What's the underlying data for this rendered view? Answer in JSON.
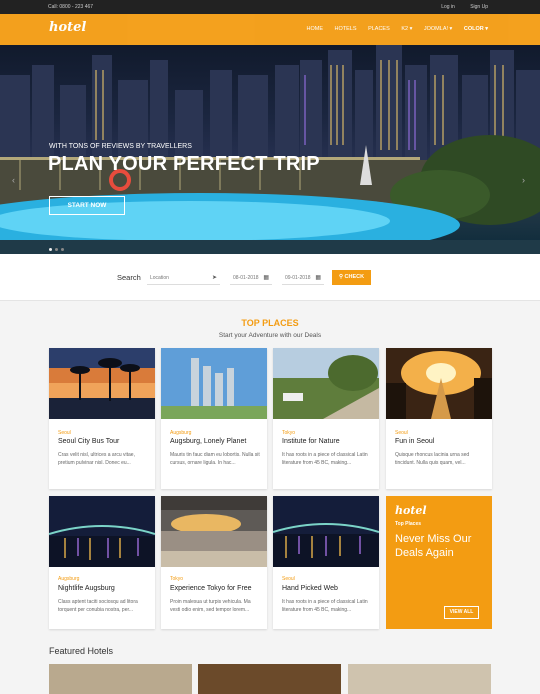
{
  "topbar": {
    "call": "Call: 0800 - 223 467",
    "login": "Log in",
    "signup": "Sign Up"
  },
  "nav": {
    "logo": "hotel",
    "items": [
      "HOME",
      "HOTELS",
      "PLACES",
      "K2 ▾",
      "JOOMLA! ▾",
      "COLOR ▾"
    ]
  },
  "hero": {
    "subtitle": "WITH TONS OF REVIEWS BY TRAVELLERS",
    "title": "PLAN YOUR PERFECT TRIP",
    "button": "START NOW",
    "prev": "‹",
    "next": "›"
  },
  "search": {
    "label": "Search",
    "location_placeholder": "Location",
    "checkin": "08-01-2018",
    "checkout": "09-01-2018",
    "button": "CHECK"
  },
  "top_places": {
    "title": "TOP PLACES",
    "subtitle": "Start your Adventure with our Deals",
    "cards": [
      {
        "category": "Seoul",
        "name": "Seoul City Bus Tour",
        "desc": "Cras velit nisl, ultrices a arcu vitae, pretium pulvinar nisl. Donec eu..."
      },
      {
        "category": "Augsburg",
        "name": "Augsburg, Lonely Planet",
        "desc": "Mauris tin fauc diam eu lobortis. Nulla sit cursus, ornare ligula. In hac..."
      },
      {
        "category": "Tokyo",
        "name": "Institute for Nature",
        "desc": "It has roots in a piece of classical Latin literature from 45 BC, making..."
      },
      {
        "category": "Seoul",
        "name": "Fun in Seoul",
        "desc": "Quisque rhoncus lacinia urna sed tincidunt. Nulla quis quam, vel..."
      },
      {
        "category": "Augsburg",
        "name": "Nightlife Augsburg",
        "desc": "Class aptent taciti sociosqu ad litora torquent per conubia nostra, per..."
      },
      {
        "category": "Tokyo",
        "name": "Experience Tokyo for Free",
        "desc": "Proin malesua ut turpis vehicula. Ma vesti odio enim, sed tempor lorem..."
      },
      {
        "category": "Seoul",
        "name": "Hand Picked Web",
        "desc": "It has roots in a piece of classical Latin literature from 45 BC, making..."
      }
    ],
    "promo": {
      "logo": "hotel",
      "tag": "Top Places",
      "heading": "Never Miss Our Deals Again",
      "button": "VIEW ALL"
    }
  },
  "featured": {
    "title": "Featured Hotels"
  },
  "colors": {
    "accent": "#f39c12",
    "topbar": "#222222"
  }
}
